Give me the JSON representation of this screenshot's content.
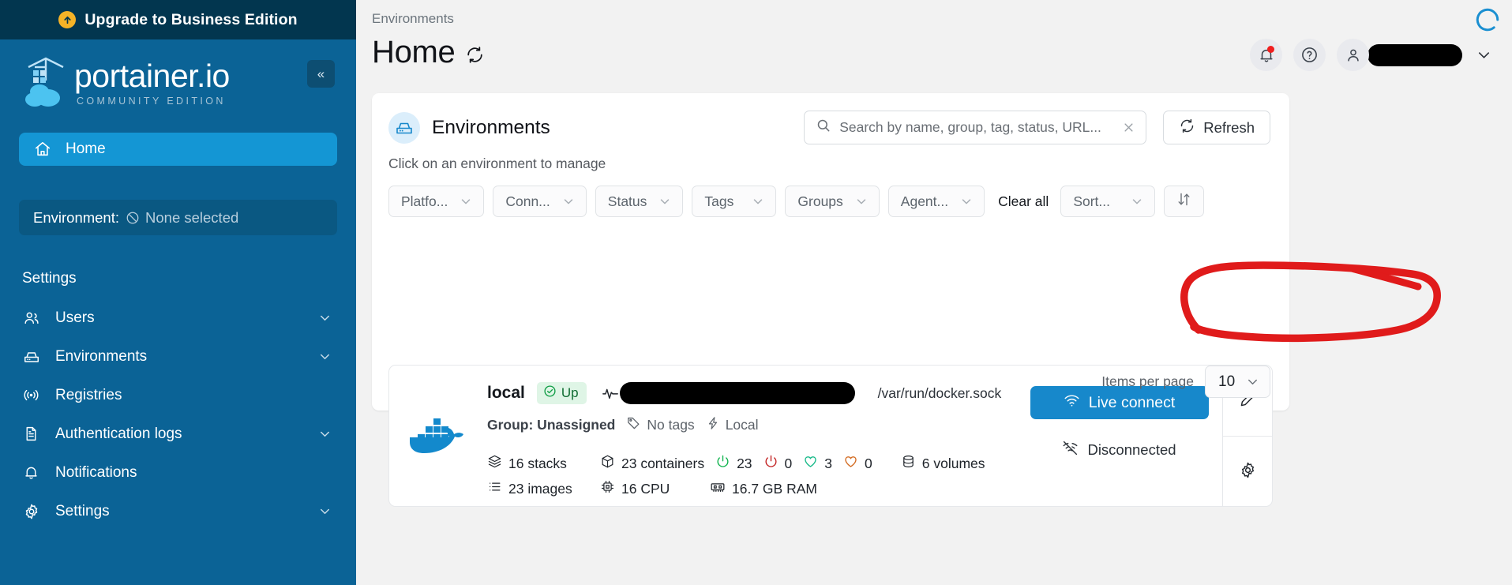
{
  "sidebar": {
    "upgrade_banner": {
      "label": "Upgrade to Business Edition",
      "icon": "arrow-up-circle-icon"
    },
    "logo": {
      "title": "portainer.io",
      "subtitle": "COMMUNITY EDITION"
    },
    "collapse_label": "«",
    "home": {
      "label": "Home",
      "icon": "home-icon"
    },
    "environment_selector": {
      "key": "Environment:",
      "value": "None selected",
      "icon": "none-selected-icon"
    },
    "settings_heading": "Settings",
    "items": [
      {
        "label": "Users",
        "icon": "users-icon",
        "has_chevron": true
      },
      {
        "label": "Environments",
        "icon": "environments-icon",
        "has_chevron": true
      },
      {
        "label": "Registries",
        "icon": "registries-icon",
        "has_chevron": false
      },
      {
        "label": "Authentication logs",
        "icon": "document-icon",
        "has_chevron": true
      },
      {
        "label": "Notifications",
        "icon": "bell-icon",
        "has_chevron": false
      },
      {
        "label": "Settings",
        "icon": "gear-icon",
        "has_chevron": true
      }
    ]
  },
  "topbar": {
    "breadcrumb": "Environments",
    "title": "Home",
    "title_refresh_icon": "refresh-icon",
    "notifications_icon": "bell-icon",
    "help_icon": "question-circle-icon",
    "user_icon": "user-icon",
    "user_name": "",
    "user_chevron": "chevron-down-icon"
  },
  "card": {
    "title": "Environments",
    "icon": "environments-icon",
    "subtitle": "Click on an environment to manage",
    "search": {
      "placeholder": "Search by name, group, tag, status, URL...",
      "value": "",
      "icon": "search-icon",
      "clear_icon": "close-icon"
    },
    "refresh_button": {
      "label": "Refresh",
      "icon": "refresh-icon"
    },
    "filters": [
      {
        "label": "Platfo...",
        "name": "platform"
      },
      {
        "label": "Conn...",
        "name": "connection"
      },
      {
        "label": "Status",
        "name": "status"
      },
      {
        "label": "Tags",
        "name": "tags"
      },
      {
        "label": "Groups",
        "name": "groups"
      },
      {
        "label": "Agent...",
        "name": "agent"
      }
    ],
    "clear_all": "Clear all",
    "sort": {
      "label": "Sort...",
      "direction_icon": "sort-direction-icon"
    },
    "footer": {
      "items_per_page_label": "Items per page",
      "items_per_page_value": "10"
    }
  },
  "environment": {
    "name": "local",
    "status_badge": {
      "label": "Up",
      "icon": "check-circle-icon"
    },
    "pulse_icon": "activity-icon",
    "url_redacted": true,
    "socket_path": "/var/run/docker.sock",
    "group": "Group: Unassigned",
    "tags": "No tags",
    "tags_icon": "tag-icon",
    "type": "Local",
    "type_icon": "lightning-icon",
    "stats": {
      "stacks": "16 stacks",
      "stacks_icon": "layers-icon",
      "containers": "23 containers",
      "containers_icon": "cube-icon",
      "containers_running": "23",
      "containers_running_icon": "power-icon",
      "containers_stopped": "0",
      "containers_stopped_icon": "power-off-icon",
      "containers_healthy": "3",
      "containers_healthy_icon": "heart-icon",
      "containers_unhealthy": "0",
      "containers_unhealthy_icon": "heart-broken-icon",
      "volumes": "6 volumes",
      "volumes_icon": "database-icon",
      "images": "23 images",
      "images_icon": "list-icon",
      "cpu": "16 CPU",
      "cpu_icon": "chip-icon",
      "ram": "16.7 GB RAM",
      "ram_icon": "memory-icon"
    },
    "live_connect": {
      "label": "Live connect",
      "icon": "wifi-icon"
    },
    "connection_status": {
      "label": "Disconnected",
      "icon": "wifi-off-icon"
    },
    "actions": [
      {
        "name": "edit",
        "icon": "pencil-icon"
      },
      {
        "name": "settings",
        "icon": "gear-icon"
      }
    ]
  },
  "colors": {
    "sidebar_bg": "#0b6396",
    "upgrade_bg": "#02364f",
    "accent_blue": "#1788cb",
    "nav_active": "#1496d4",
    "status_up_bg": "#dff5e6",
    "status_up_text": "#0f6c31",
    "annotation_red": "#e01b1b",
    "notification_dot": "#f01e1e"
  }
}
